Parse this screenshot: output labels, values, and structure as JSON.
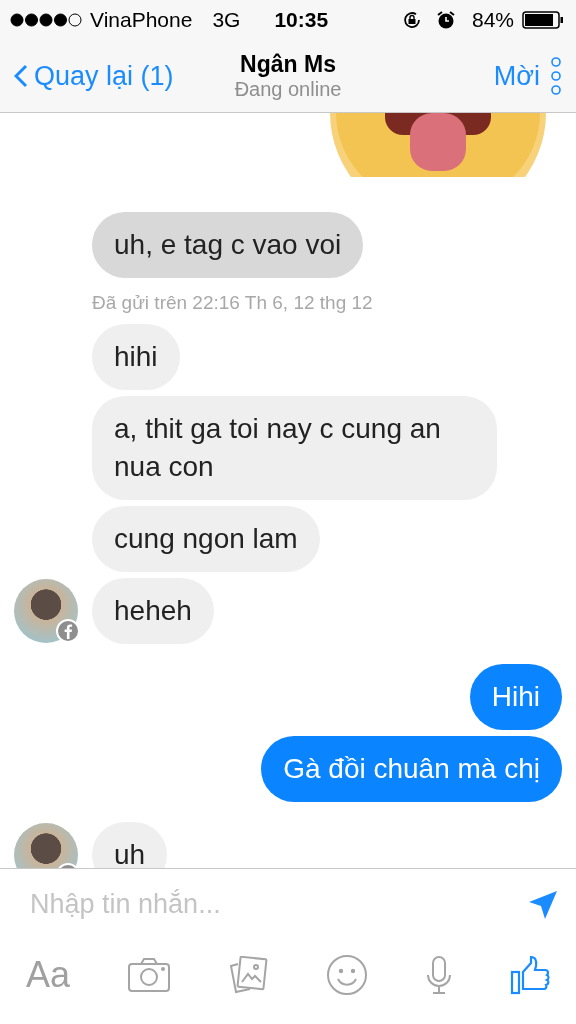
{
  "status_bar": {
    "carrier": "VinaPhone",
    "network": "3G",
    "time": "10:35",
    "battery": "84%"
  },
  "header": {
    "back": "Quay lại (1)",
    "title": "Ngân Ms",
    "subtitle": "Đang online",
    "action": "Mời"
  },
  "messages": [
    {
      "kind": "received",
      "text": "uh, e tag c vao voi",
      "selected": true,
      "avatar": false
    },
    {
      "kind": "timestamp",
      "text": "Đã gửi trên 22:16 Th 6, 12 thg 12"
    },
    {
      "kind": "received",
      "text": "hihi",
      "selected": false,
      "avatar": false
    },
    {
      "kind": "received",
      "text": "a, thit ga toi nay c cung an nua con",
      "selected": false,
      "avatar": false
    },
    {
      "kind": "received",
      "text": "cung ngon lam",
      "selected": false,
      "avatar": false
    },
    {
      "kind": "received",
      "text": "heheh",
      "selected": false,
      "avatar": true
    },
    {
      "kind": "sent",
      "text": "Hihi"
    },
    {
      "kind": "sent",
      "text": "Gà đồi chuân mà chị"
    },
    {
      "kind": "received",
      "text": "uh",
      "selected": false,
      "avatar": true
    }
  ],
  "composer": {
    "placeholder": "Nhập tin nhắn..."
  },
  "toolbar": {
    "text_button": "Aa"
  }
}
